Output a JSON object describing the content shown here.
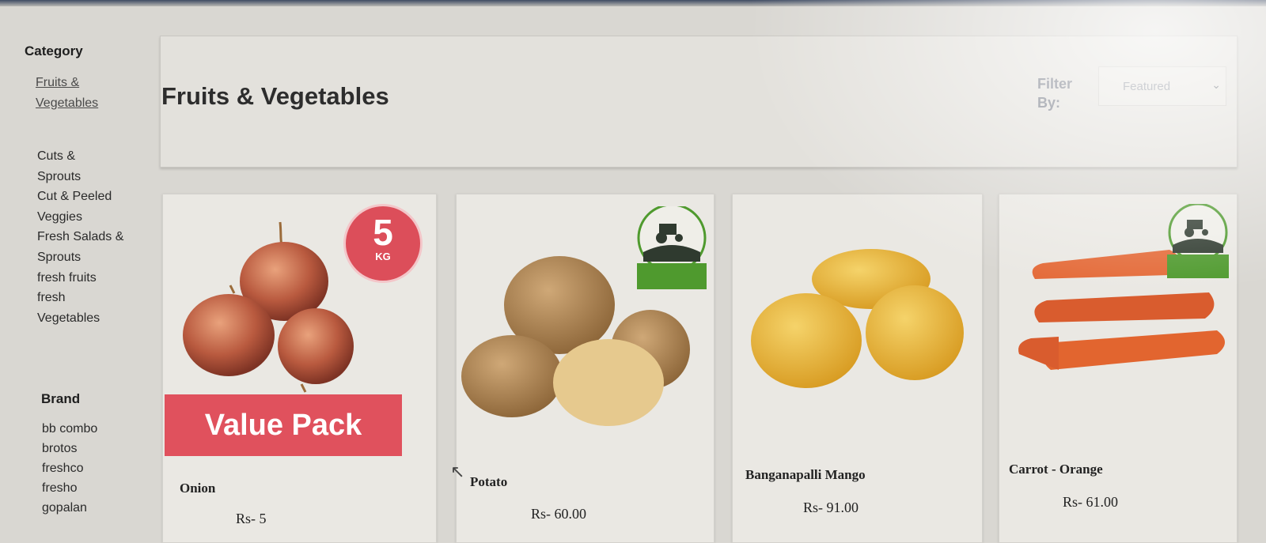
{
  "sidebar": {
    "category_heading": "Category",
    "active_category": "Fruits & Vegetables",
    "categories": [
      "Cuts & Sprouts",
      "Cut & Peeled Veggies",
      "Fresh Salads & Sprouts",
      "fresh fruits",
      "fresh Vegetables"
    ],
    "brand_heading": "Brand",
    "brands": [
      "bb combo",
      "brotos",
      "freshco",
      "fresho",
      "gopalan"
    ]
  },
  "header": {
    "title": "Fruits & Vegetables",
    "filter_label": "Filter By:",
    "filter_value": "Featured"
  },
  "products": [
    {
      "name": "Onion",
      "price": "Rs- 5",
      "badge": "5",
      "badge_unit": "KG",
      "banner": "Value Pack"
    },
    {
      "name": "Potato",
      "price": "Rs- 60.00"
    },
    {
      "name": "Banganapalli Mango",
      "price": "Rs- 91.00"
    },
    {
      "name": "Carrot - Orange",
      "price": "Rs- 61.00"
    }
  ],
  "colors": {
    "accent_red": "#e0515d",
    "farm_green": "#4f9a2e"
  }
}
